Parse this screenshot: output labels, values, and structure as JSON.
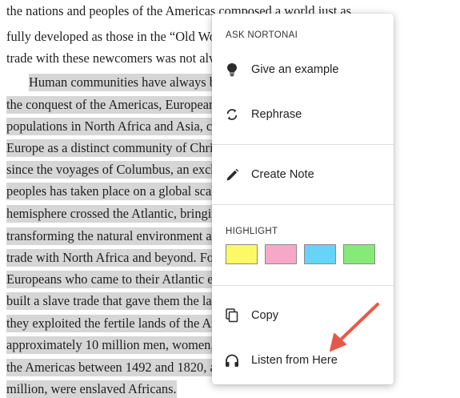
{
  "text_lines": [
    "the nations and peoples of the Americas composed a world just as",
    "fully developed as those in the “Old World” of the Europeans,",
    "trade with these newcomers was not always welcome or wanted.",
    "Human communities have always been in contact with places before",
    "the conquest of the Americas, Europeans traded with Muslim",
    "populations in North Africa and Asia, creating the idea of",
    "Europe as a distinct community of Christian believers. But",
    "since the voyages of Columbus, an exchange of cultures and",
    "peoples has taken place on a global scale. The western",
    "hemisphere crossed the Atlantic, bringing plants and",
    "transforming the natural environment and expanding",
    "trade with North Africa and beyond. For both",
    "Europeans who came to their Atlantic empires, Europeans",
    "built a slave trade that gave them the labor with which",
    "they exploited the fertile lands of the Americas. Indeed, of",
    "approximately 10 million men, women, and children who crossed to",
    "the Americas between 1492 and 1820, about 7.7",
    "million, were enslaved Africans."
  ],
  "menu": {
    "heading": "ASK NORTONAI",
    "ai_items": [
      {
        "label": "Give an example",
        "icon": "lightbulb-icon"
      },
      {
        "label": "Rephrase",
        "icon": "rephrase-icon"
      }
    ],
    "note_item": {
      "label": "Create Note",
      "icon": "pencil-icon"
    },
    "highlight_heading": "HIGHLIGHT",
    "highlight_colors": [
      {
        "name": "yellow",
        "color": "#fdf964"
      },
      {
        "name": "pink",
        "color": "#f7a8c8"
      },
      {
        "name": "blue",
        "color": "#66d3f7"
      },
      {
        "name": "green",
        "color": "#86ea77"
      }
    ],
    "copy_item": {
      "label": "Copy",
      "icon": "copy-icon"
    },
    "listen_item": {
      "label": "Listen from Here",
      "icon": "headphones-icon"
    }
  },
  "colors": {
    "selection": "#d6d6d6",
    "annotation_arrow": "#e8584a"
  }
}
